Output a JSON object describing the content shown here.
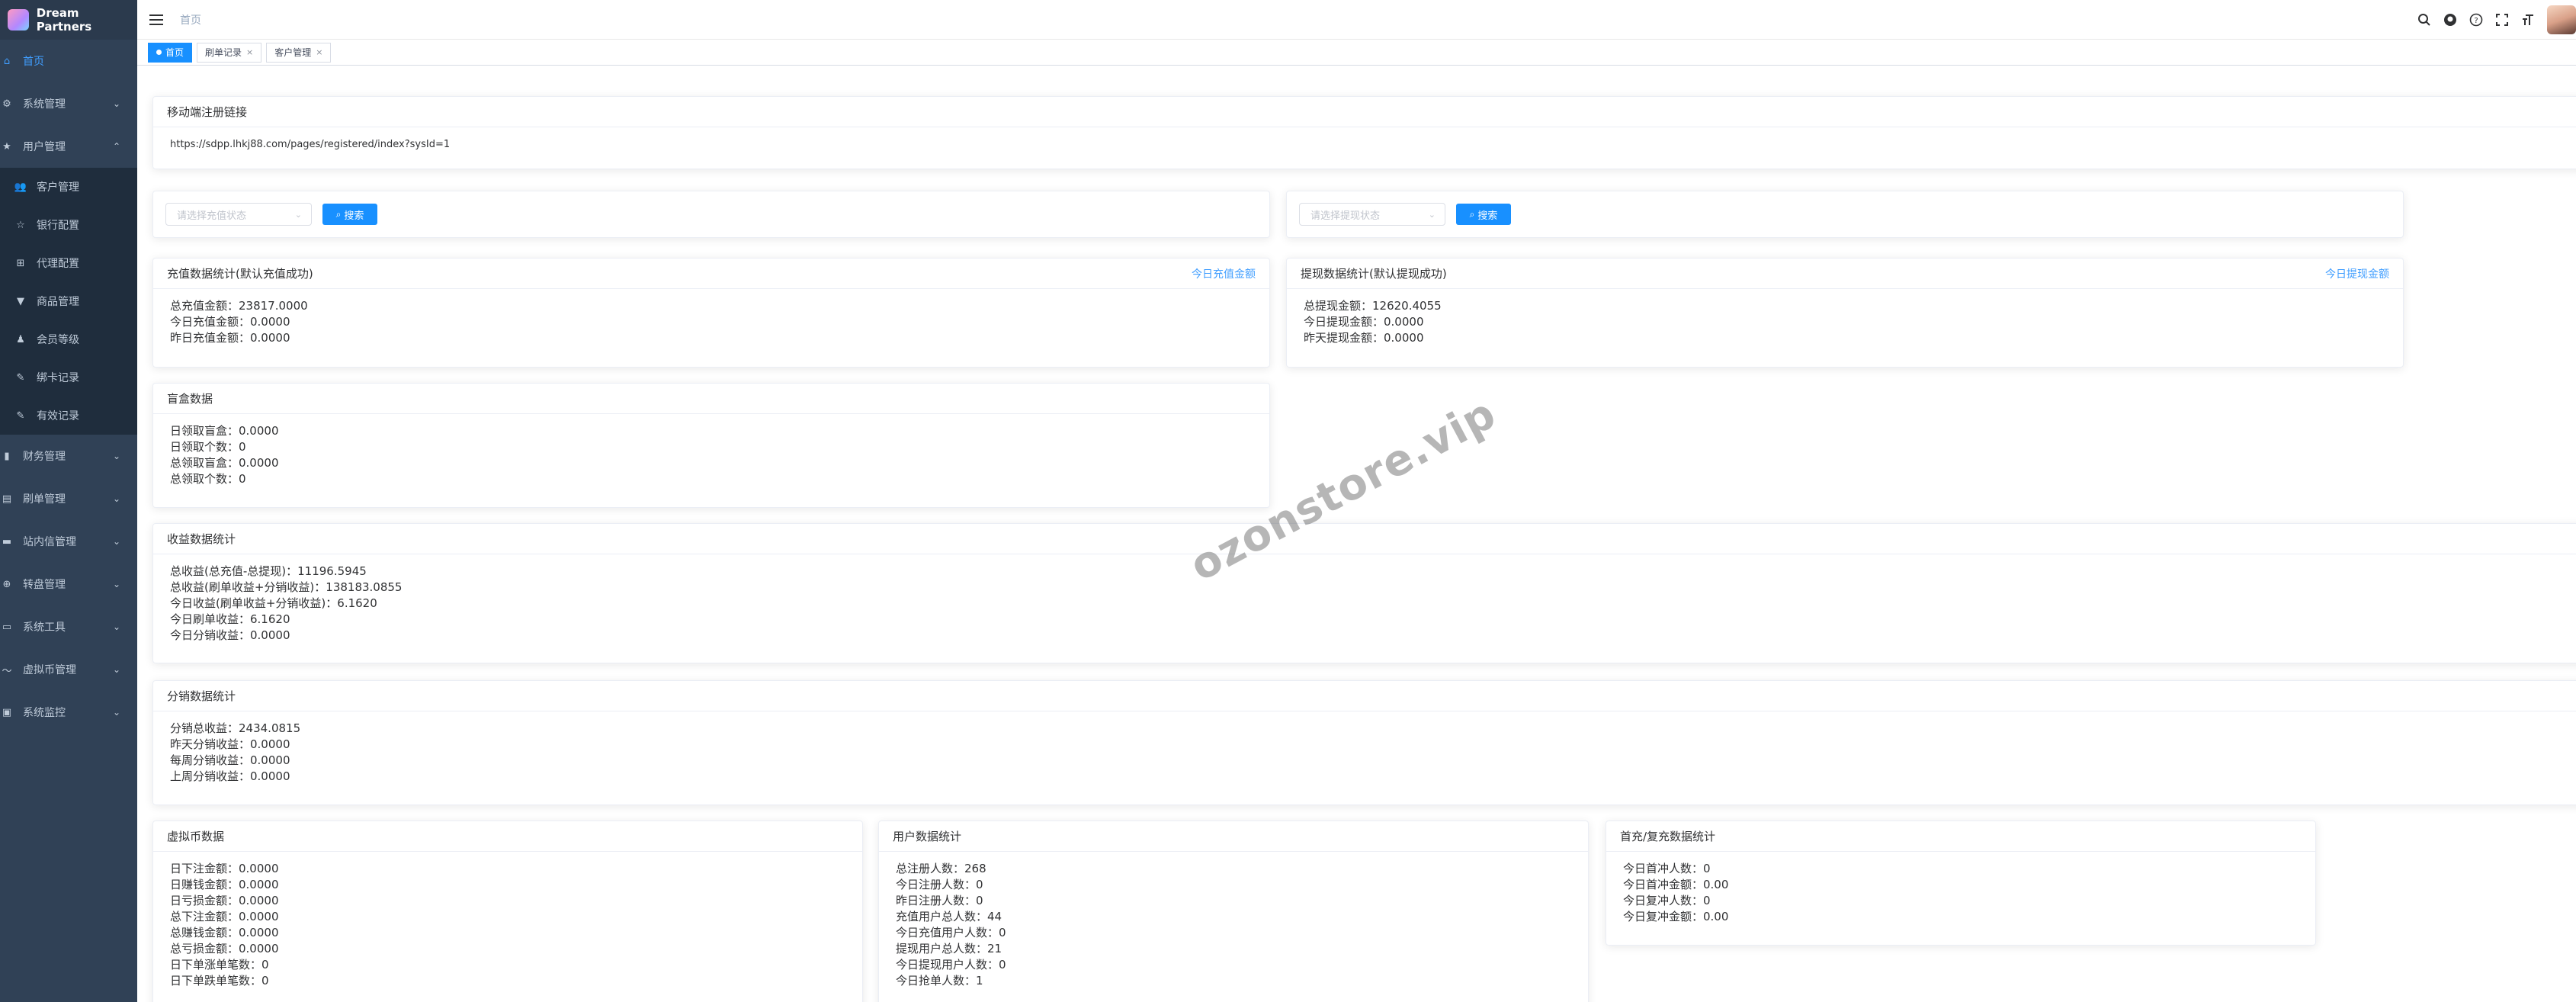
{
  "app": {
    "name": "Dream Partners"
  },
  "sidebar": {
    "items": [
      {
        "label": "首页",
        "icon": "home-icon",
        "active": true
      },
      {
        "label": "系统管理",
        "icon": "gear-icon"
      },
      {
        "label": "用户管理",
        "icon": "star-icon"
      },
      {
        "label": "财务管理",
        "icon": "bar-chart-icon"
      },
      {
        "label": "刷单管理",
        "icon": "order-icon"
      },
      {
        "label": "站内信管理",
        "icon": "mail-icon"
      },
      {
        "label": "转盘管理",
        "icon": "wheel-icon"
      },
      {
        "label": "系统工具",
        "icon": "tool-icon"
      },
      {
        "label": "虚拟币管理",
        "icon": "coin-icon"
      },
      {
        "label": "系统监控",
        "icon": "monitor-icon"
      }
    ],
    "user_submenu": [
      {
        "label": "客户管理",
        "icon": "users-icon"
      },
      {
        "label": "银行配置",
        "icon": "star-outline-icon"
      },
      {
        "label": "代理配置",
        "icon": "tree-icon"
      },
      {
        "label": "商品管理",
        "icon": "shirt-icon"
      },
      {
        "label": "会员等级",
        "icon": "level-icon"
      },
      {
        "label": "绑卡记录",
        "icon": "edit-icon"
      },
      {
        "label": "有效记录",
        "icon": "edit-icon"
      }
    ]
  },
  "navbar": {
    "breadcrumb": "首页"
  },
  "tags": [
    {
      "label": "首页",
      "active": true
    },
    {
      "label": "刷单记录"
    },
    {
      "label": "客户管理"
    }
  ],
  "close_glyph": "×",
  "register_link": {
    "title": "移动端注册链接",
    "url": "https://sdpp.lhkj88.com/pages/registered/index?sysId=1"
  },
  "filters": {
    "recharge_placeholder": "请选择充值状态",
    "withdraw_placeholder": "请选择提现状态",
    "search_label": "搜索"
  },
  "recharge": {
    "title": "充值数据统计(默认充值成功)",
    "link": "今日充值金额",
    "lines": [
      "总充值金额：23817.0000",
      "今日充值金额：0.0000",
      "昨日充值金额：0.0000"
    ]
  },
  "withdraw": {
    "title": "提现数据统计(默认提现成功)",
    "link": "今日提现金额",
    "lines": [
      "总提现金额：12620.4055",
      "今日提现金额：0.0000",
      "昨天提现金额：0.0000"
    ]
  },
  "blindbox": {
    "title": "盲盒数据",
    "lines": [
      "日领取盲盒：0.0000",
      "日领取个数：0",
      "总领取盲盒：0.0000",
      "总领取个数：0"
    ]
  },
  "income": {
    "title": "收益数据统计",
    "lines": [
      "总收益(总充值-总提现)：11196.5945",
      "总收益(刷单收益+分销收益)：138183.0855",
      "今日收益(刷单收益+分销收益)：6.1620",
      "今日刷单收益：6.1620",
      "今日分销收益：0.0000"
    ]
  },
  "distribution": {
    "title": "分销数据统计",
    "lines": [
      "分销总收益：2434.0815",
      "昨天分销收益：0.0000",
      "每周分销收益：0.0000",
      "上周分销收益：0.0000"
    ]
  },
  "crypto": {
    "title": "虚拟币数据",
    "lines": [
      "日下注金额：0.0000",
      "日赚钱金额：0.0000",
      "日亏损金额：0.0000",
      "总下注金额：0.0000",
      "总赚钱金额：0.0000",
      "总亏损金额：0.0000",
      "日下单涨单笔数：0",
      "日下单跌单笔数：0"
    ]
  },
  "users": {
    "title": "用户数据统计",
    "lines": [
      "总注册人数：268",
      "今日注册人数：0",
      "昨日注册人数：0",
      "充值用户总人数：44",
      "今日充值用户人数：0",
      "提现用户总人数：21",
      "今日提现用户人数：0",
      "今日抢单人数：1"
    ]
  },
  "first_recharge": {
    "title": "首充/复充数据统计",
    "lines": [
      "今日首冲人数：0",
      "今日首冲金额：0.00",
      "今日复冲人数：0",
      "今日复冲金额：0.00"
    ]
  },
  "watermark": "ozonstore.vip",
  "colors": {
    "sidebar_bg": "#304156",
    "primary": "#1890ff",
    "link": "#409eff"
  }
}
